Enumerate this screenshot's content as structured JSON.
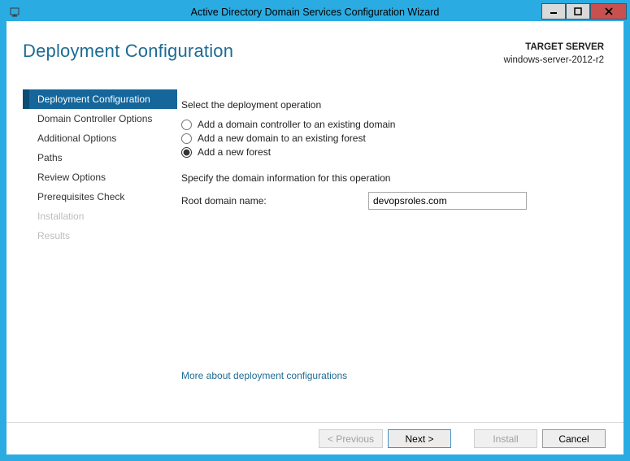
{
  "window": {
    "title": "Active Directory Domain Services Configuration Wizard"
  },
  "heading": "Deployment Configuration",
  "target": {
    "label": "TARGET SERVER",
    "server": "windows-server-2012-r2"
  },
  "steps": [
    {
      "label": "Deployment Configuration",
      "state": "active"
    },
    {
      "label": "Domain Controller Options",
      "state": "normal"
    },
    {
      "label": "Additional Options",
      "state": "normal"
    },
    {
      "label": "Paths",
      "state": "normal"
    },
    {
      "label": "Review Options",
      "state": "normal"
    },
    {
      "label": "Prerequisites Check",
      "state": "normal"
    },
    {
      "label": "Installation",
      "state": "disabled"
    },
    {
      "label": "Results",
      "state": "disabled"
    }
  ],
  "main": {
    "select_label": "Select the deployment operation",
    "options": {
      "opt1": "Add a domain controller to an existing domain",
      "opt2": "Add a new domain to an existing forest",
      "opt3": "Add a new forest"
    },
    "specify_label": "Specify the domain information for this operation",
    "root_domain_label": "Root domain name:",
    "root_domain_value": "devopsroles.com",
    "more_link": "More about deployment configurations"
  },
  "footer": {
    "previous": "< Previous",
    "next": "Next >",
    "install": "Install",
    "cancel": "Cancel"
  }
}
